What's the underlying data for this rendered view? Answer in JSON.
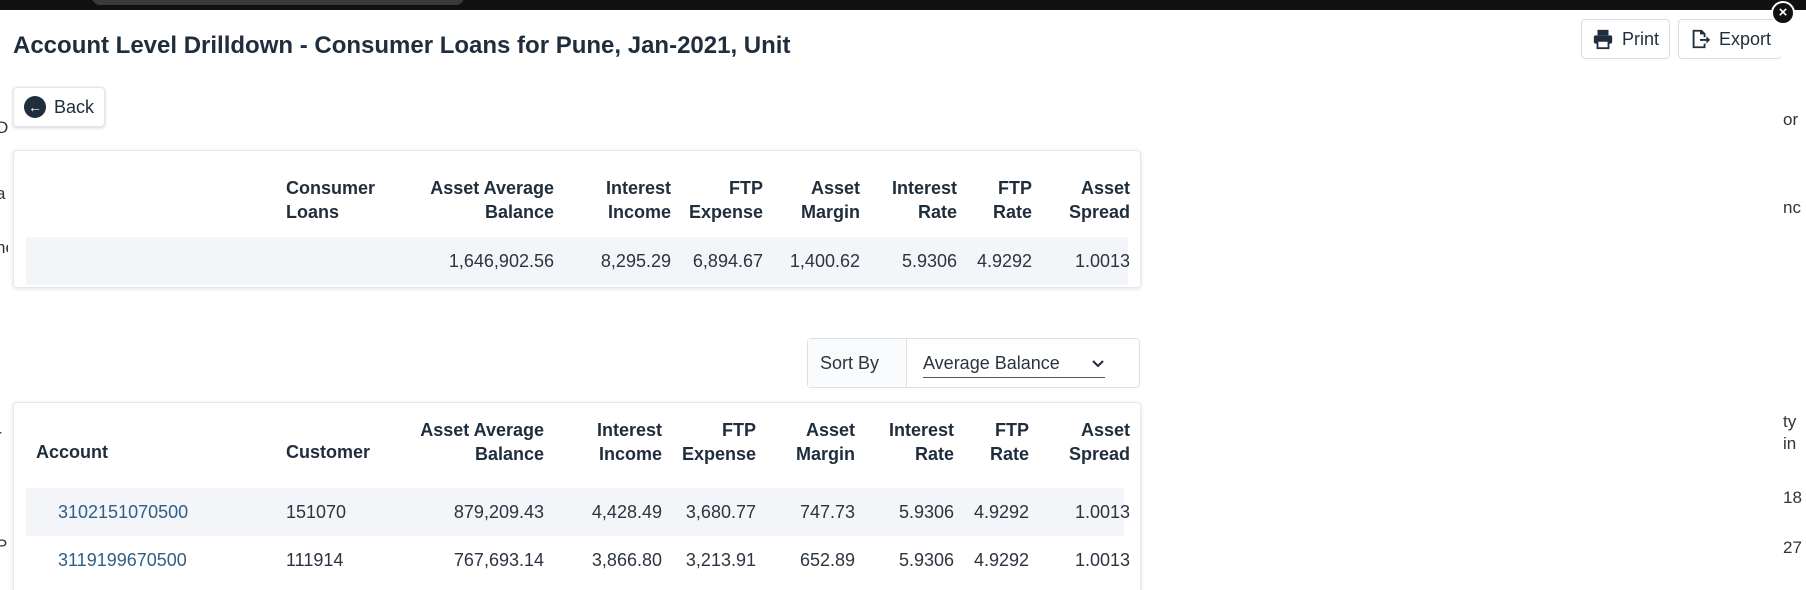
{
  "title": "Account Level Drilldown - Consumer Loans for Pune, Jan-2021, Unit",
  "toolbar": {
    "print_label": "Print",
    "export_label": "Export"
  },
  "back_label": "Back",
  "close_glyph": "×",
  "summary": {
    "headers": {
      "col1": [
        "Consumer",
        "Loans"
      ],
      "col2": [
        "Asset Average",
        "Balance"
      ],
      "col3": [
        "Interest",
        "Income"
      ],
      "col4": [
        "FTP",
        "Expense"
      ],
      "col5": [
        "Asset",
        "Margin"
      ],
      "col6": [
        "Interest",
        "Rate"
      ],
      "col7": [
        "FTP",
        "Rate"
      ],
      "col8": [
        "Asset",
        "Spread"
      ]
    },
    "row": {
      "consumer_loans": "",
      "asset_average_balance": "1,646,902.56",
      "interest_income": "8,295.29",
      "ftp_expense": "6,894.67",
      "asset_margin": "1,400.62",
      "interest_rate": "5.9306",
      "ftp_rate": "4.9292",
      "asset_spread": "1.0013"
    }
  },
  "sort": {
    "label": "Sort By",
    "selected": "Average Balance"
  },
  "detail": {
    "headers": {
      "account": "Account",
      "customer": "Customer",
      "col3": [
        "Asset Average",
        "Balance"
      ],
      "col4": [
        "Interest",
        "Income"
      ],
      "col5": [
        "FTP",
        "Expense"
      ],
      "col6": [
        "Asset",
        "Margin"
      ],
      "col7": [
        "Interest",
        "Rate"
      ],
      "col8": [
        "FTP",
        "Rate"
      ],
      "col9": [
        "Asset",
        "Spread"
      ]
    },
    "rows": [
      {
        "account": "3102151070500",
        "customer": "151070",
        "asset_average_balance": "879,209.43",
        "interest_income": "4,428.49",
        "ftp_expense": "3,680.77",
        "asset_margin": "747.73",
        "interest_rate": "5.9306",
        "ftp_rate": "4.9292",
        "asset_spread": "1.0013"
      },
      {
        "account": "3119199670500",
        "customer": "111914",
        "asset_average_balance": "767,693.14",
        "interest_income": "3,866.80",
        "ftp_expense": "3,213.91",
        "asset_margin": "652.89",
        "interest_rate": "5.9306",
        "ftp_rate": "4.9292",
        "asset_spread": "1.0013"
      }
    ]
  },
  "backdrop": {
    "left_fragments": [
      "D",
      "a",
      "ne",
      "r",
      "Pu"
    ],
    "right_fragments": [
      "or",
      "nc",
      "ty",
      "in",
      "18",
      "27"
    ]
  }
}
